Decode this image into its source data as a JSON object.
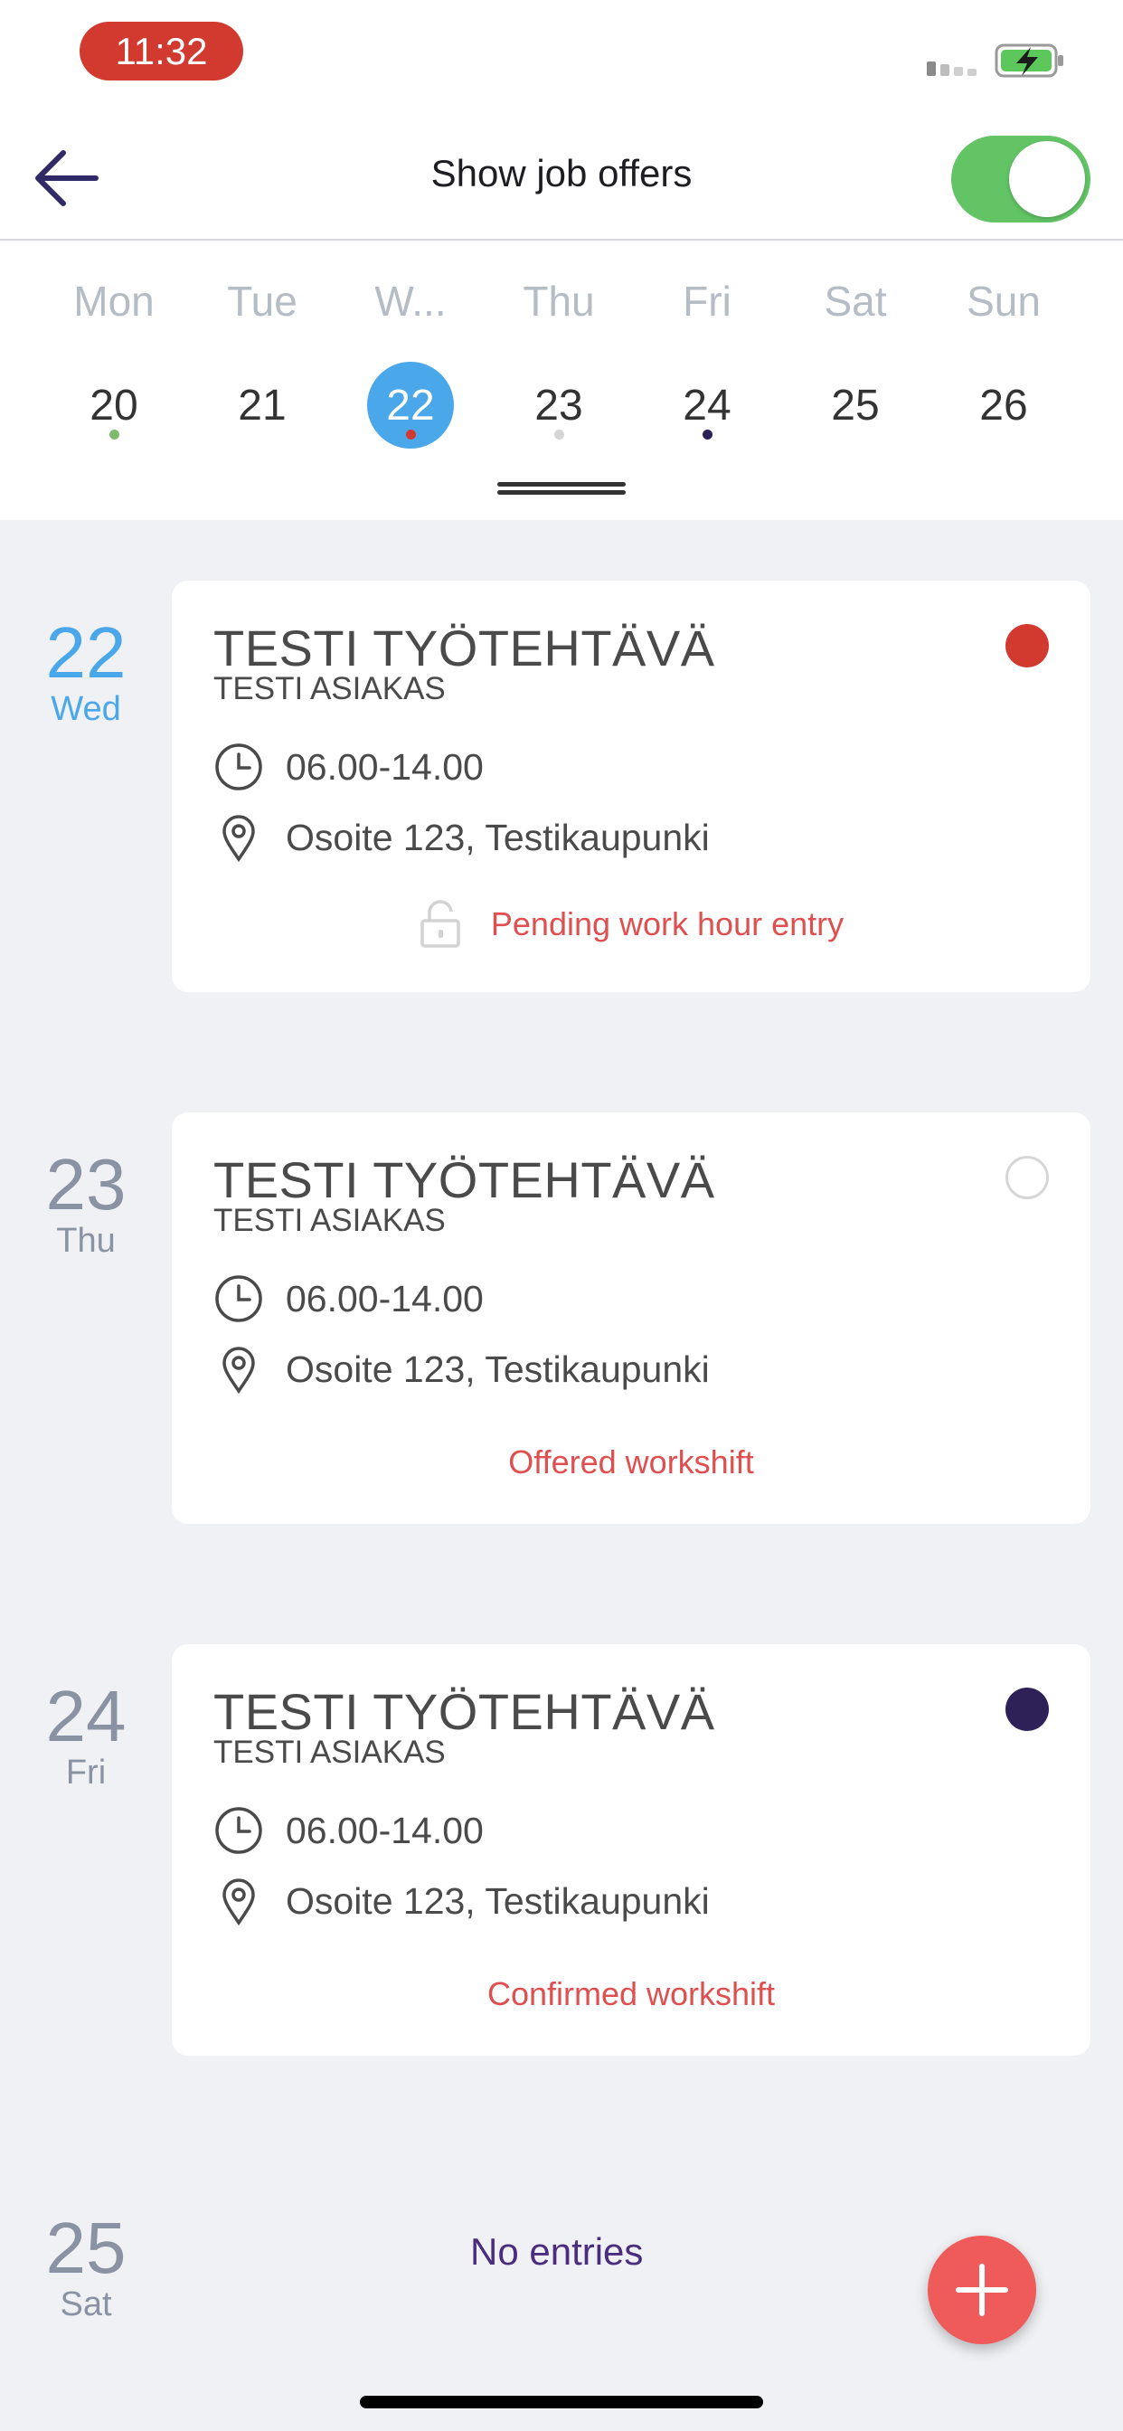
{
  "status_bar": {
    "time": "11:32"
  },
  "header": {
    "title": "Show job offers",
    "toggle_on": true
  },
  "colors": {
    "accent_blue": "#4aa8ea",
    "toggle_green": "#62c465",
    "red": "#d2392f",
    "status_text_red": "#e04f4f",
    "confirmed_purple": "#2d2157",
    "no_entries_purple": "#4b2d7f"
  },
  "week": {
    "days": [
      {
        "name": "Mon",
        "date": "20",
        "dot": "#7dbb6d",
        "selected": false
      },
      {
        "name": "Tue",
        "date": "21",
        "dot": null,
        "selected": false
      },
      {
        "name": "W...",
        "date": "22",
        "dot": "#d2392f",
        "selected": true
      },
      {
        "name": "Thu",
        "date": "23",
        "dot": "#d6d6d6",
        "selected": false
      },
      {
        "name": "Fri",
        "date": "24",
        "dot": "#2d2157",
        "selected": false
      },
      {
        "name": "Sat",
        "date": "25",
        "dot": null,
        "selected": false
      },
      {
        "name": "Sun",
        "date": "26",
        "dot": null,
        "selected": false
      }
    ]
  },
  "entries": [
    {
      "day_num": "22",
      "day_name": "Wed",
      "title": "TESTI TYÖTEHTÄVÄ",
      "customer": "TESTI ASIAKAS",
      "time": "06.00-14.00",
      "address": "Osoite 123, Testikaupunki",
      "status": "Pending work hour entry",
      "status_icon": "lock-open-icon",
      "dot": "filled-red"
    },
    {
      "day_num": "23",
      "day_name": "Thu",
      "title": "TESTI TYÖTEHTÄVÄ",
      "customer": "TESTI ASIAKAS",
      "time": "06.00-14.00",
      "address": "Osoite 123, Testikaupunki",
      "status": "Offered workshift",
      "dot": "outline-grey"
    },
    {
      "day_num": "24",
      "day_name": "Fri",
      "title": "TESTI TYÖTEHTÄVÄ",
      "customer": "TESTI ASIAKAS",
      "time": "06.00-14.00",
      "address": "Osoite 123, Testikaupunki",
      "status": "Confirmed workshift",
      "dot": "filled-purple"
    }
  ],
  "empty_day": {
    "day_num": "25",
    "day_name": "Sat",
    "text": "No entries"
  },
  "icons": {
    "back": "arrow-left-icon",
    "clock": "clock-icon",
    "location": "map-pin-icon",
    "lock": "lock-open-icon",
    "add": "plus-icon",
    "battery": "battery-charging-icon",
    "signal": "signal-icon"
  }
}
